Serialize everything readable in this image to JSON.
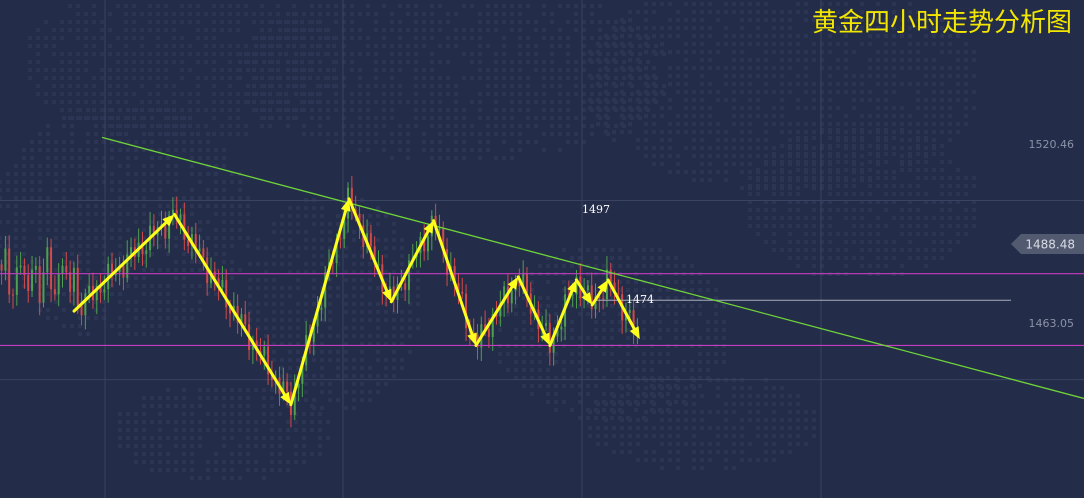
{
  "chart_data": {
    "type": "candlestick",
    "title": "黄金四小时走势分析图",
    "y_ticks": [
      {
        "label": "1520.46",
        "value": 1520.46
      },
      {
        "label": "1463.05",
        "value": 1463.05
      }
    ],
    "current_price": {
      "label": "1488.48",
      "value": 1488.48
    },
    "support_resistance": [
      {
        "name": "resistance",
        "value": 1497
      },
      {
        "name": "support",
        "value": 1474
      }
    ],
    "trendline": {
      "start": [
        0,
        1541
      ],
      "end": [
        205,
        1457
      ]
    },
    "annotations": [
      {
        "label": "1497",
        "x": 114,
        "y": 1500
      },
      {
        "label": "1474",
        "x": 125,
        "y": 1470
      }
    ],
    "wave_path": [
      [
        14,
        1485
      ],
      [
        33,
        1516
      ],
      [
        55,
        1455
      ],
      [
        66,
        1521
      ],
      [
        74,
        1488
      ],
      [
        82,
        1514
      ],
      [
        90,
        1474
      ],
      [
        98,
        1496
      ],
      [
        104,
        1474
      ],
      [
        109,
        1495
      ],
      [
        112,
        1487
      ],
      [
        115,
        1495
      ],
      [
        121,
        1476
      ]
    ],
    "x_range": [
      0,
      205
    ],
    "y_range": [
      1436,
      1560
    ],
    "colors": {
      "background": "#232c48",
      "bull": "#4fa04f",
      "bear": "#d24a4a",
      "trendline": "#6fd43a",
      "hline": "#c43dc4",
      "current_line": "#a8adbb",
      "arrow": "#ffff1e",
      "title": "#f2e600"
    }
  }
}
